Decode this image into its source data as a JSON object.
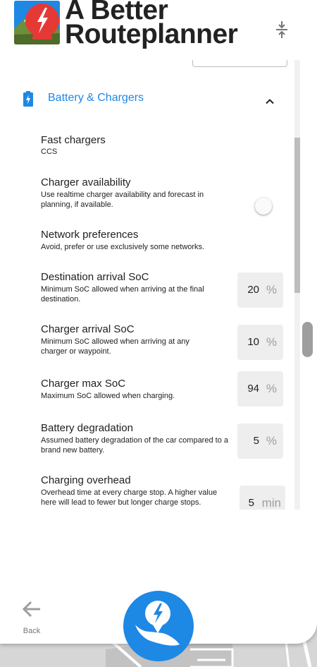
{
  "app": {
    "logo_line1": "A Better",
    "logo_line2": "Routeplanner",
    "collapse_icon": "vertical-collapse-icon"
  },
  "section": {
    "title": "Battery & Chargers",
    "icon": "battery-charging-icon",
    "chevron": "chevron-up-icon"
  },
  "settings": {
    "fast_chargers": {
      "title": "Fast chargers",
      "desc": "CCS"
    },
    "charger_availability": {
      "title": "Charger availability",
      "desc": "Use realtime charger availability and forecast in planning, if available.",
      "enabled": false
    },
    "network_preferences": {
      "title": "Network preferences",
      "desc": "Avoid, prefer or use exclusively some networks."
    },
    "destination_arrival_soc": {
      "title": "Destination arrival SoC",
      "desc": "Minimum SoC allowed when arriving at the final destination.",
      "value": "20",
      "unit": "%"
    },
    "charger_arrival_soc": {
      "title": "Charger arrival SoC",
      "desc": "Minimum SoC allowed when arriving at any charger or waypoint.",
      "value": "10",
      "unit": "%"
    },
    "charger_max_soc": {
      "title": "Charger max SoC",
      "desc": "Maximum SoC allowed when charging.",
      "value": "94",
      "unit": "%"
    },
    "battery_degradation": {
      "title": "Battery degradation",
      "desc": "Assumed battery degradation of the car compared to a brand new battery.",
      "value": "5",
      "unit": "%"
    },
    "charging_overhead": {
      "title": "Charging overhead",
      "desc": "Overhead time at every charge stop. A higher value here will lead to fewer but longer charge stops.",
      "value": "5",
      "unit": "min"
    }
  },
  "nav": {
    "back_label": "Back",
    "back_icon": "arrow-left-icon",
    "fab_icon": "plan-route-icon"
  },
  "colors": {
    "accent": "#1e88e5",
    "logo_red": "#e53935",
    "logo_blue": "#1565c0"
  }
}
